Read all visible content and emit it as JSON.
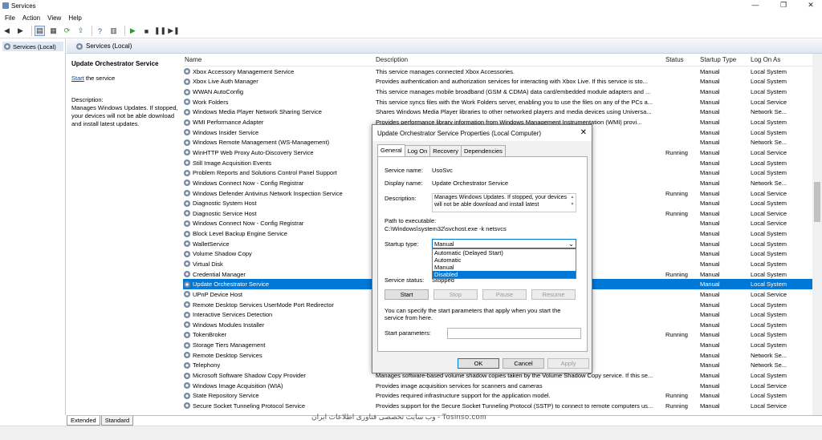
{
  "window": {
    "title": "Services",
    "minimize": "—",
    "maximize": "❐",
    "close": "✕"
  },
  "menu": [
    "File",
    "Action",
    "View",
    "Help"
  ],
  "tree": {
    "root": "Services (Local)"
  },
  "header": {
    "title": "Services (Local)"
  },
  "detail": {
    "service_name": "Update Orchestrator Service",
    "start_link": "Start",
    "start_suffix": " the service",
    "description_label": "Description:",
    "description": "Manages Windows Updates. If stopped, your devices will not be able download and install latest updates."
  },
  "columns": [
    "Name",
    "Description",
    "Status",
    "Startup Type",
    "Log On As"
  ],
  "services": [
    {
      "name": "Xbox Accessory Management Service",
      "desc": "This service manages connected Xbox Accessories.",
      "status": "",
      "startup": "Manual",
      "logon": "Local System"
    },
    {
      "name": "Xbox Live Auth Manager",
      "desc": "Provides authentication and authorization services for interacting with Xbox Live. If this service is sto...",
      "status": "",
      "startup": "Manual",
      "logon": "Local System"
    },
    {
      "name": "WWAN AutoConfig",
      "desc": "This service manages mobile broadband (GSM & CDMA) data card/embedded module adapters and ...",
      "status": "",
      "startup": "Manual",
      "logon": "Local System"
    },
    {
      "name": "Work Folders",
      "desc": "This service syncs files with the Work Folders server, enabling you to use the files on any of the PCs a...",
      "status": "",
      "startup": "Manual",
      "logon": "Local Service"
    },
    {
      "name": "Windows Media Player Network Sharing Service",
      "desc": "Shares Windows Media Player libraries to other networked players and media devices using Universa...",
      "status": "",
      "startup": "Manual",
      "logon": "Network Se..."
    },
    {
      "name": "WMI Performance Adapter",
      "desc": "Provides performance library information from Windows Management Instrumentation (WMI) provi...",
      "status": "",
      "startup": "Manual",
      "logon": "Local System"
    },
    {
      "name": "Windows Insider Service",
      "desc": "",
      "status": "",
      "startup": "Manual",
      "logon": "Local System"
    },
    {
      "name": "Windows Remote Management (WS-Management)",
      "desc": "",
      "status": "",
      "startup": "Manual",
      "logon": "Network Se..."
    },
    {
      "name": "WinHTTP Web Proxy Auto-Discovery Service",
      "desc": "in32 API and COM Auto...",
      "status": "Running",
      "startup": "Manual",
      "logon": "Local Service"
    },
    {
      "name": "Still Image Acquisition Events",
      "desc": "",
      "status": "",
      "startup": "Manual",
      "logon": "Local System"
    },
    {
      "name": "Problem Reports and Solutions Control Panel Support",
      "desc": "vel problem reports for t...",
      "status": "",
      "startup": "Manual",
      "logon": "Local System"
    },
    {
      "name": "Windows Connect Now - Config Registrar",
      "desc": "that support WS-Mana...",
      "status": "",
      "startup": "Manual",
      "logon": "Network Se..."
    },
    {
      "name": "Windows Defender Antivirus Network Inspection Service",
      "desc": "d vulnerabilities in net...",
      "status": "Running",
      "startup": "Manual",
      "logon": "Local Service"
    },
    {
      "name": "Diagnostic System Host",
      "desc": "that need to ...",
      "status": "",
      "startup": "Manual",
      "logon": "Local System"
    },
    {
      "name": "Diagnostic Service Host",
      "desc": "that need to ...",
      "status": "Running",
      "startup": "Manual",
      "logon": "Local Service"
    },
    {
      "name": "Windows Connect Now - Config Registrar",
      "desc": "'s Implementation of ...",
      "status": "",
      "startup": "Manual",
      "logon": "Local Service"
    },
    {
      "name": "Block Level Backup Engine Service",
      "desc": "covery operations. If th...",
      "status": "",
      "startup": "Manual",
      "logon": "Local System"
    },
    {
      "name": "WalletService",
      "desc": "",
      "status": "",
      "startup": "Manual",
      "logon": "Local System"
    },
    {
      "name": "Volume Shadow Copy",
      "desc": "purposes. If this servic...",
      "status": "",
      "startup": "Manual",
      "logon": "Local System"
    },
    {
      "name": "Virtual Disk",
      "desc": "rays.",
      "status": "",
      "startup": "Manual",
      "logon": "Local System"
    },
    {
      "name": "Credential Manager",
      "desc": "",
      "status": "Running",
      "startup": "Manual",
      "logon": "Local System"
    },
    {
      "name": "Update Orchestrator Service",
      "desc": "ad and install latest udp...",
      "status": "",
      "startup": "Manual",
      "logon": "Local System"
    },
    {
      "name": "UPnP Device Host",
      "desc": "based UPnP devices on...",
      "status": "",
      "startup": "Manual",
      "logon": "Local Service"
    },
    {
      "name": "Remote Desktop Services UserMode Port Redirector",
      "desc": "",
      "status": "",
      "startup": "Manual",
      "logon": "Local System"
    },
    {
      "name": "Interactive Services Detection",
      "desc": "nose to dialogs create...",
      "status": "",
      "startup": "Manual",
      "logon": "Local System"
    },
    {
      "name": "Windows Modules Installer",
      "desc": "ional components. If th...",
      "status": "",
      "startup": "Manual",
      "logon": "Local System"
    },
    {
      "name": "TokenBroker",
      "desc": "",
      "status": "Running",
      "startup": "Manual",
      "logon": "Local System"
    },
    {
      "name": "Storage Tiers Management",
      "desc": "n the system.",
      "status": "",
      "startup": "Manual",
      "logon": "Local System"
    },
    {
      "name": "Remote Desktop Services",
      "desc": "and Remote Desktop Se...",
      "status": "",
      "startup": "Manual",
      "logon": "Network Se..."
    },
    {
      "name": "Telephony",
      "desc": "",
      "status": "",
      "startup": "Manual",
      "logon": "Network Se..."
    },
    {
      "name": "Microsoft Software Shadow Copy Provider",
      "desc": "Manages software-based volume shadow copies taken by the Volume Shadow Copy service. If this se...",
      "status": "",
      "startup": "Manual",
      "logon": "Local System"
    },
    {
      "name": "Windows Image Acquisition (WIA)",
      "desc": "Provides image acquisition services for scanners and cameras",
      "status": "",
      "startup": "Manual",
      "logon": "Local Service"
    },
    {
      "name": "State Repository Service",
      "desc": "Provides required infrastructure support for the application model.",
      "status": "Running",
      "startup": "Manual",
      "logon": "Local System"
    },
    {
      "name": "Secure Socket Tunneling Protocol Service",
      "desc": "Provides support for the Secure Socket Tunneling Protocol (SSTP) to connect to remote computers us...",
      "status": "Running",
      "startup": "Manual",
      "logon": "Local Service"
    }
  ],
  "selected_index": 21,
  "bottom_tabs": [
    "Extended",
    "Standard"
  ],
  "watermark": "وب سایت تخصصی فناوری اطلاعات ایران - Tosinso.com",
  "dialog": {
    "title": "Update Orchestrator Service Properties (Local Computer)",
    "close": "✕",
    "tabs": [
      "General",
      "Log On",
      "Recovery",
      "Dependencies"
    ],
    "service_name_label": "Service name:",
    "service_name": "UsoSvc",
    "display_name_label": "Display name:",
    "display_name": "Update Orchestrator Service",
    "description_label": "Description:",
    "description": "Manages Windows Updates. If stopped, your devices will not be able download and install latest",
    "path_label": "Path to executable:",
    "path": "C:\\Windows\\system32\\svchost.exe -k netsvcs",
    "startup_label": "Startup type:",
    "startup_value": "Manual",
    "startup_options": [
      "Automatic (Delayed Start)",
      "Automatic",
      "Manual",
      "Disabled"
    ],
    "highlighted_option": 3,
    "status_label": "Service status:",
    "status_value": "Stopped",
    "btn_start": "Start",
    "btn_stop": "Stop",
    "btn_pause": "Pause",
    "btn_resume": "Resume",
    "hint": "You can specify the start parameters that apply when you start the service from here.",
    "params_label": "Start parameters:",
    "ok": "OK",
    "cancel": "Cancel",
    "apply": "Apply"
  }
}
